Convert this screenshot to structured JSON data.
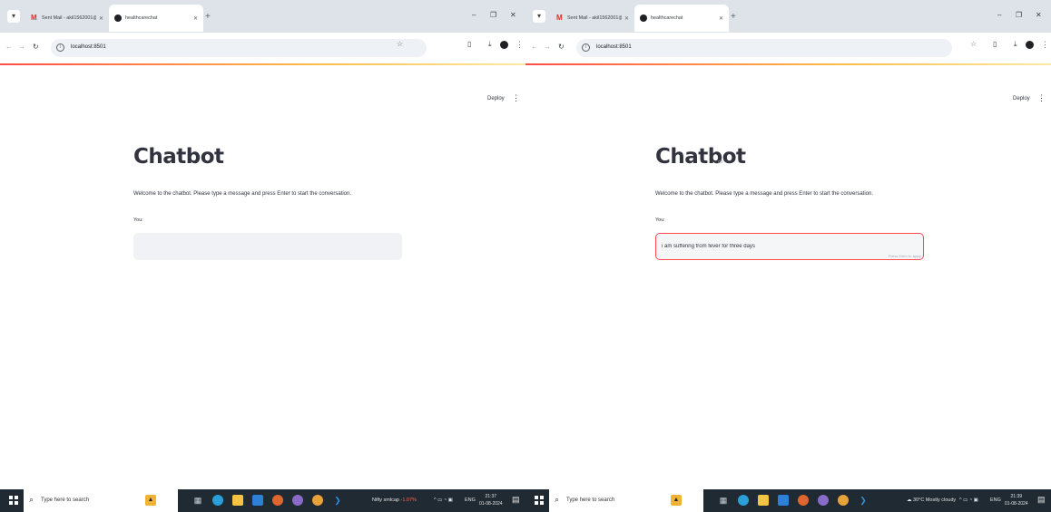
{
  "screens": [
    {
      "browser": {
        "tabs": [
          {
            "title": "Sent Mail - akil1562001@gmai",
            "icon": "gmail-icon"
          },
          {
            "title": "healthcarechat",
            "icon": "streamlit-icon"
          }
        ],
        "url": "localhost:8501"
      },
      "app": {
        "deploy_label": "Deploy",
        "title": "Chatbot",
        "welcome": "Welcome to the chatbot. Please type a message and press Enter to start the conversation.",
        "input_label": "You:",
        "input_value": "",
        "input_hint": ""
      },
      "taskbar": {
        "search_placeholder": "Type here to search",
        "tray_text": "Nifty smlcap",
        "tray_change": "-1.07%",
        "lang": "ENG",
        "time": "21:37",
        "date": "01-08-2024"
      }
    },
    {
      "browser": {
        "tabs": [
          {
            "title": "Sent Mail - akil1562001@gmai",
            "icon": "gmail-icon"
          },
          {
            "title": "healthcarechat",
            "icon": "streamlit-icon"
          }
        ],
        "url": "localhost:8501"
      },
      "app": {
        "deploy_label": "Deploy",
        "title": "Chatbot",
        "welcome": "Welcome to the chatbot. Please type a message and press Enter to start the conversation.",
        "input_label": "You:",
        "input_value": "i am suffering from fever for three days",
        "input_hint": "Press Enter to apply"
      },
      "taskbar": {
        "search_placeholder": "Type here to search",
        "tray_text": "30°C  Mostly cloudy",
        "tray_change": "",
        "lang": "ENG",
        "time": "21:39",
        "date": "01-08-2024"
      }
    }
  ],
  "colors": {
    "accent": "#ff4b4b",
    "input_bg": "#f0f2f6",
    "tabstrip": "#dee3ea",
    "taskbar": "#1f2a33"
  }
}
